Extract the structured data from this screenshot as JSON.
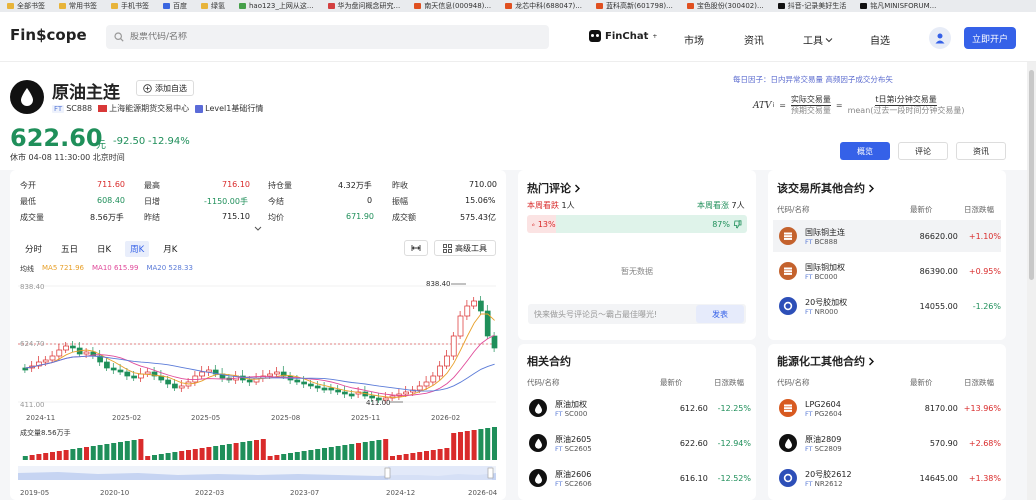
{
  "bookmarks": [
    "全部书签",
    "常用书签",
    "手机书签",
    "百度",
    "绿氢",
    "hao123_上网从这...",
    "华为盘问概念研究...",
    "南天信息(000948)...",
    "龙芯中科(688047)...",
    "蓝科高新(601798)...",
    "宝色股份(300402)...",
    "抖音-记录美好生活",
    "铭凡MINISFORUM..."
  ],
  "nav": {
    "logo": "Fin$cope",
    "search_placeholder": "股票代码/名称",
    "finchat": "FinChat",
    "finchat_sup": "+",
    "market": "市场",
    "news": "资讯",
    "tools": "工具",
    "watchlist": "自选",
    "open_account": "立即开户"
  },
  "header": {
    "name": "原油主连",
    "add_watch": "添加自选",
    "code_tag": "FT",
    "code": "SC888",
    "exchange": "上海能源期货交易中心",
    "level": "Level1基础行情",
    "price": "622.60",
    "unit": "元",
    "change": "-92.50",
    "change_pct": "-12.94%",
    "time": "休市 04-08 11:30:00 北京时间"
  },
  "ad": {
    "top": "每日因子：日内异常交易量 高频因子成交分布矢",
    "label_atv": "ATV",
    "label_actual": "实际交易量",
    "label_expect": "预期交易量",
    "label_day": "t日第i分钟交易量",
    "label_mean": "mean(过去一段时间分钟交易量)"
  },
  "view_tabs": [
    "概览",
    "评论",
    "资讯"
  ],
  "stats": {
    "open_label": "今开",
    "open": "711.60",
    "high_label": "最高",
    "high": "716.10",
    "oi_label": "持仓量",
    "oi": "4.32万手",
    "prev_label": "昨收",
    "prev": "710.00",
    "low_label": "最低",
    "low": "608.40",
    "dayinc_label": "日增",
    "dayinc": "-1150.00手",
    "settle_label": "今结",
    "settle": "0",
    "amp_label": "振幅",
    "amp": "15.06%",
    "vol_label": "成交量",
    "vol": "8.56万手",
    "prevsettle_label": "昨结",
    "prevsettle": "715.10",
    "avg_label": "均价",
    "avg": "671.90",
    "amount_label": "成交额",
    "amount": "575.43亿"
  },
  "kline": {
    "tabs": [
      "分时",
      "五日",
      "日K",
      "周K",
      "月K"
    ],
    "active": "周K",
    "advanced": "高级工具",
    "ma_label": "均线",
    "ma5": "MA5 721.96",
    "ma10": "MA10 615.99",
    "ma20": "MA20 528.33",
    "y_top": "838.40",
    "y_mid": "624.70",
    "y_low": "411.00",
    "max_tag": "838.40",
    "min_tag": "411.00",
    "x_labels": [
      "2024-11",
      "2025-02",
      "2025-05",
      "2025-08",
      "2025-11",
      "2026-02"
    ],
    "vol_label": "成交量8.56万手",
    "nav_labels": [
      "2019-05",
      "2020-10",
      "2022-03",
      "2023-07",
      "2024-12",
      "2026-04"
    ]
  },
  "hot": {
    "title": "热门评论",
    "down_label": "本周看跌",
    "down_count": "1人",
    "up_label": "本周看涨",
    "up_count": "7人",
    "down_pct": "13%",
    "up_pct": "87%",
    "empty": "暂无数据",
    "comment_placeholder": "快来做头号评论员～霸占最佳曝光!",
    "post": "发表"
  },
  "related": {
    "title": "相关合约",
    "col1": "代码/名称",
    "col2": "最新价",
    "col3": "日涨跌幅",
    "items": [
      {
        "name": "原油加权",
        "code": "SC000",
        "price": "612.60",
        "pct": "-12.25%"
      },
      {
        "name": "原油2605",
        "code": "SC2605",
        "price": "622.60",
        "pct": "-12.94%"
      },
      {
        "name": "原油2606",
        "code": "SC2606",
        "price": "616.10",
        "pct": "-12.52%"
      }
    ]
  },
  "exchange_other": {
    "title": "该交易所其他合约",
    "col1": "代码/名称",
    "col2": "最新价",
    "col3": "日涨跌幅",
    "items": [
      {
        "name": "国际铜主连",
        "code": "BC888",
        "price": "86620.00",
        "pct": "+1.10%"
      },
      {
        "name": "国际铜加权",
        "code": "BC000",
        "price": "86390.00",
        "pct": "+0.95%"
      },
      {
        "name": "20号胶加权",
        "code": "NR000",
        "price": "14055.00",
        "pct": "-1.26%"
      }
    ]
  },
  "energy_other": {
    "title": "能源化工其他合约",
    "col1": "代码/名称",
    "col2": "最新价",
    "col3": "日涨跌幅",
    "items": [
      {
        "name": "LPG2604",
        "code": "PG2604",
        "price": "8170.00",
        "pct": "+13.96%"
      },
      {
        "name": "原油2809",
        "code": "SC2809",
        "price": "570.90",
        "pct": "+2.68%"
      },
      {
        "name": "20号胶2612",
        "code": "NR2612",
        "price": "14645.00",
        "pct": "+1.38%"
      }
    ]
  },
  "colors": {
    "up": "#d92b2b",
    "down": "#1f8f5a",
    "accent": "#3561e8",
    "ma5": "#e8a02a",
    "ma10": "#e04a9a",
    "ma20": "#5b7bd8"
  }
}
